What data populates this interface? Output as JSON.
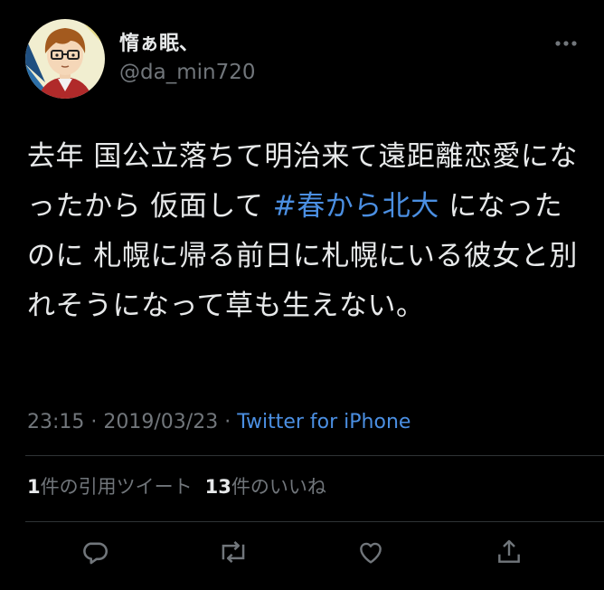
{
  "user": {
    "display_name": "惰ぁ眠、",
    "handle": "@da_min720"
  },
  "tweet": {
    "text_before": "去年 国公立落ちて明治来て遠距離恋愛になったから 仮面して ",
    "hashtag": "#春から北大",
    "text_after": " になったのに 札幌に帰る前日に札幌にいる彼女と別れそうになって草も生えない。"
  },
  "meta": {
    "time": "23:15",
    "separator1": " · ",
    "date": "2019/03/23",
    "separator2": " · ",
    "source": "Twitter for iPhone"
  },
  "stats": {
    "quote_count": "1",
    "quote_label": "件の引用ツイート",
    "like_count": "13",
    "like_label": "件のいいね"
  },
  "icons": {
    "more": "more-horizontal-icon",
    "reply": "reply-icon",
    "retweet": "retweet-icon",
    "like": "heart-icon",
    "share": "share-icon"
  },
  "colors": {
    "background": "#000000",
    "text": "#e7e9ea",
    "muted": "#71767b",
    "link": "#4b8fe2",
    "divider": "#2f3336"
  }
}
